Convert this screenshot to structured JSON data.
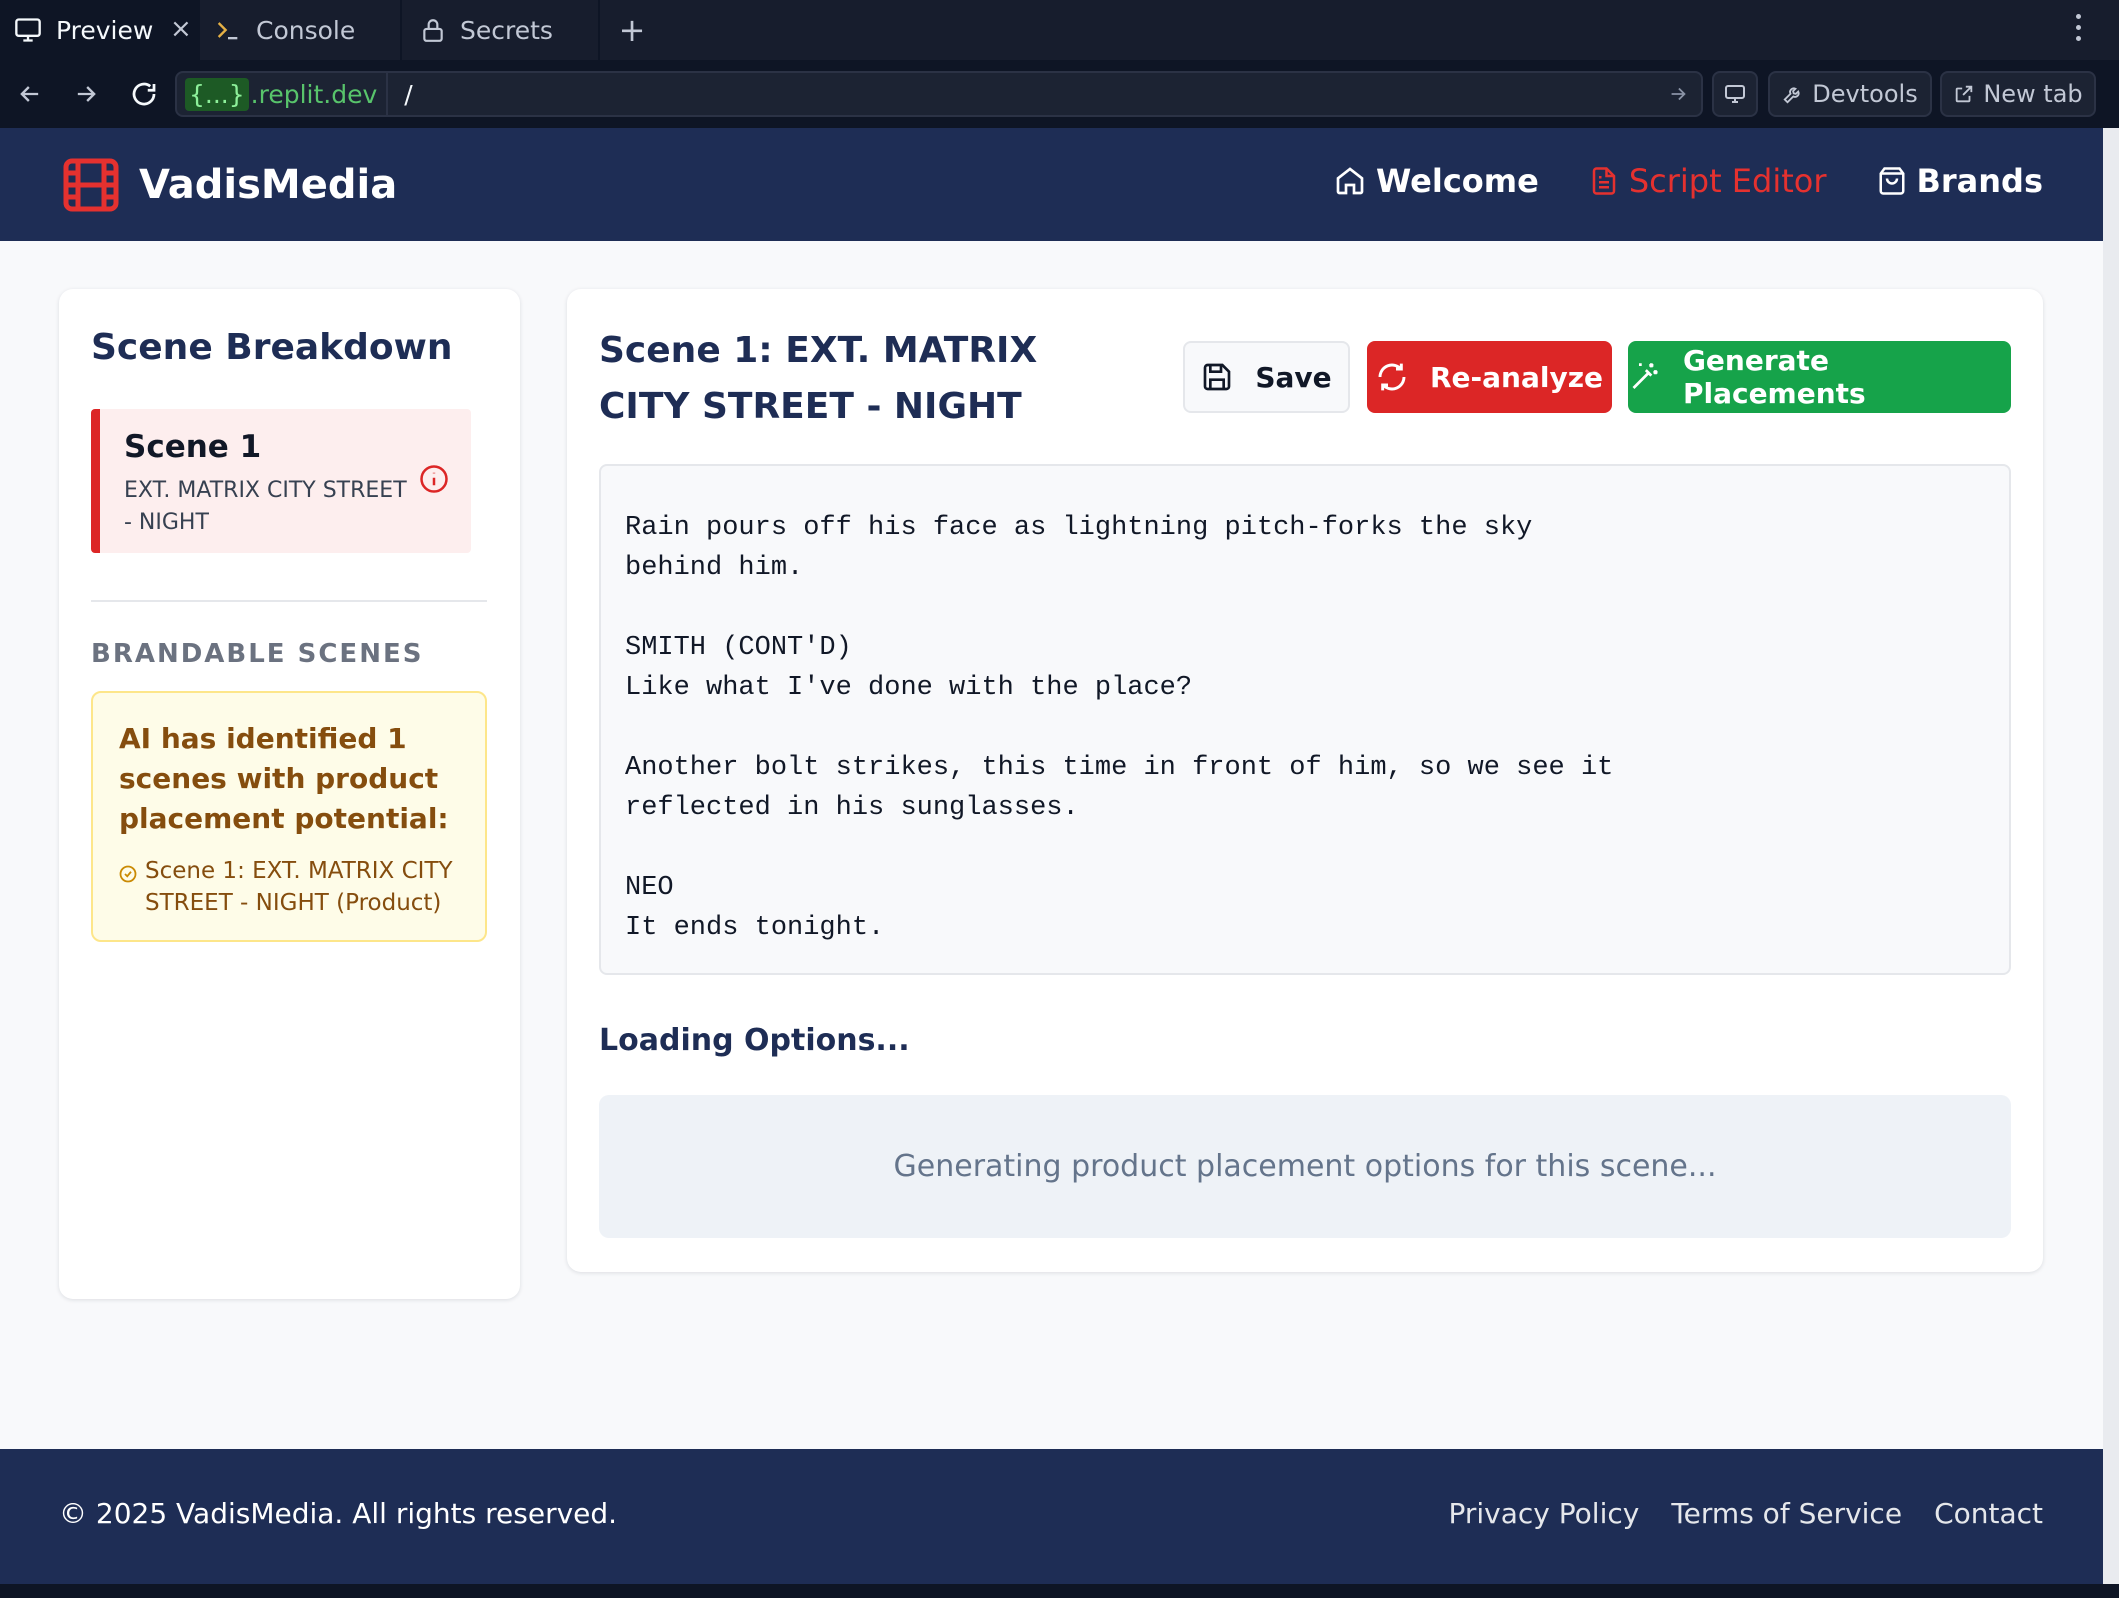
{
  "browser": {
    "tabs": [
      {
        "label": "Preview",
        "icon": "monitor-icon",
        "active": true
      },
      {
        "label": "Console",
        "icon": "terminal-icon",
        "active": false
      },
      {
        "label": "Secrets",
        "icon": "lock-icon",
        "active": false
      }
    ],
    "close_glyph": "×",
    "new_tab_glyph": "+",
    "url": {
      "dynamic": "{...}",
      "host": ".replit.dev",
      "path": "/"
    },
    "devtools_label": "Devtools",
    "newtab_label": "New tab"
  },
  "header": {
    "brand": "VadisMedia",
    "nav": [
      {
        "label": "Welcome",
        "icon": "home-icon",
        "active": false
      },
      {
        "label": "Script Editor",
        "icon": "document-icon",
        "active": true
      },
      {
        "label": "Brands",
        "icon": "shopping-bag-icon",
        "active": false
      }
    ],
    "colors": {
      "bar": "#1e2d55",
      "active": "#e5312f",
      "logo": "#e5312f"
    }
  },
  "sidebar": {
    "title": "Scene Breakdown",
    "scenes": [
      {
        "title": "Scene 1",
        "subtitle": "EXT. MATRIX CITY STREET - NIGHT",
        "icon": "info-icon"
      }
    ],
    "brandable_title": "BRANDABLE SCENES",
    "ai_message": "AI has identified 1 scenes with product placement potential:",
    "brandable_items": [
      {
        "label": "Scene 1: EXT. MATRIX CITY STREET - NIGHT (Product)",
        "icon": "check-circle-icon"
      }
    ]
  },
  "main": {
    "scene_title": "Scene 1: EXT. MATRIX CITY STREET - NIGHT",
    "buttons": {
      "save": "Save",
      "reanalyze": "Re-analyze",
      "generate": "Generate Placements"
    },
    "script_text": "y\n\nRain pours off his face as lightning pitch-forks the sky\nbehind him.\n\nSMITH (CONT'D)\nLike what I've done with the place?\n\nAnother bolt strikes, this time in front of him, so we see it\nreflected in his sunglasses.\n\nNEO\nIt ends tonight.",
    "loading_title": "Loading Options...",
    "loading_message": "Generating product placement options for this scene..."
  },
  "footer": {
    "copyright": "© 2025 VadisMedia. All rights reserved.",
    "links": [
      "Privacy Policy",
      "Terms of Service",
      "Contact"
    ]
  }
}
